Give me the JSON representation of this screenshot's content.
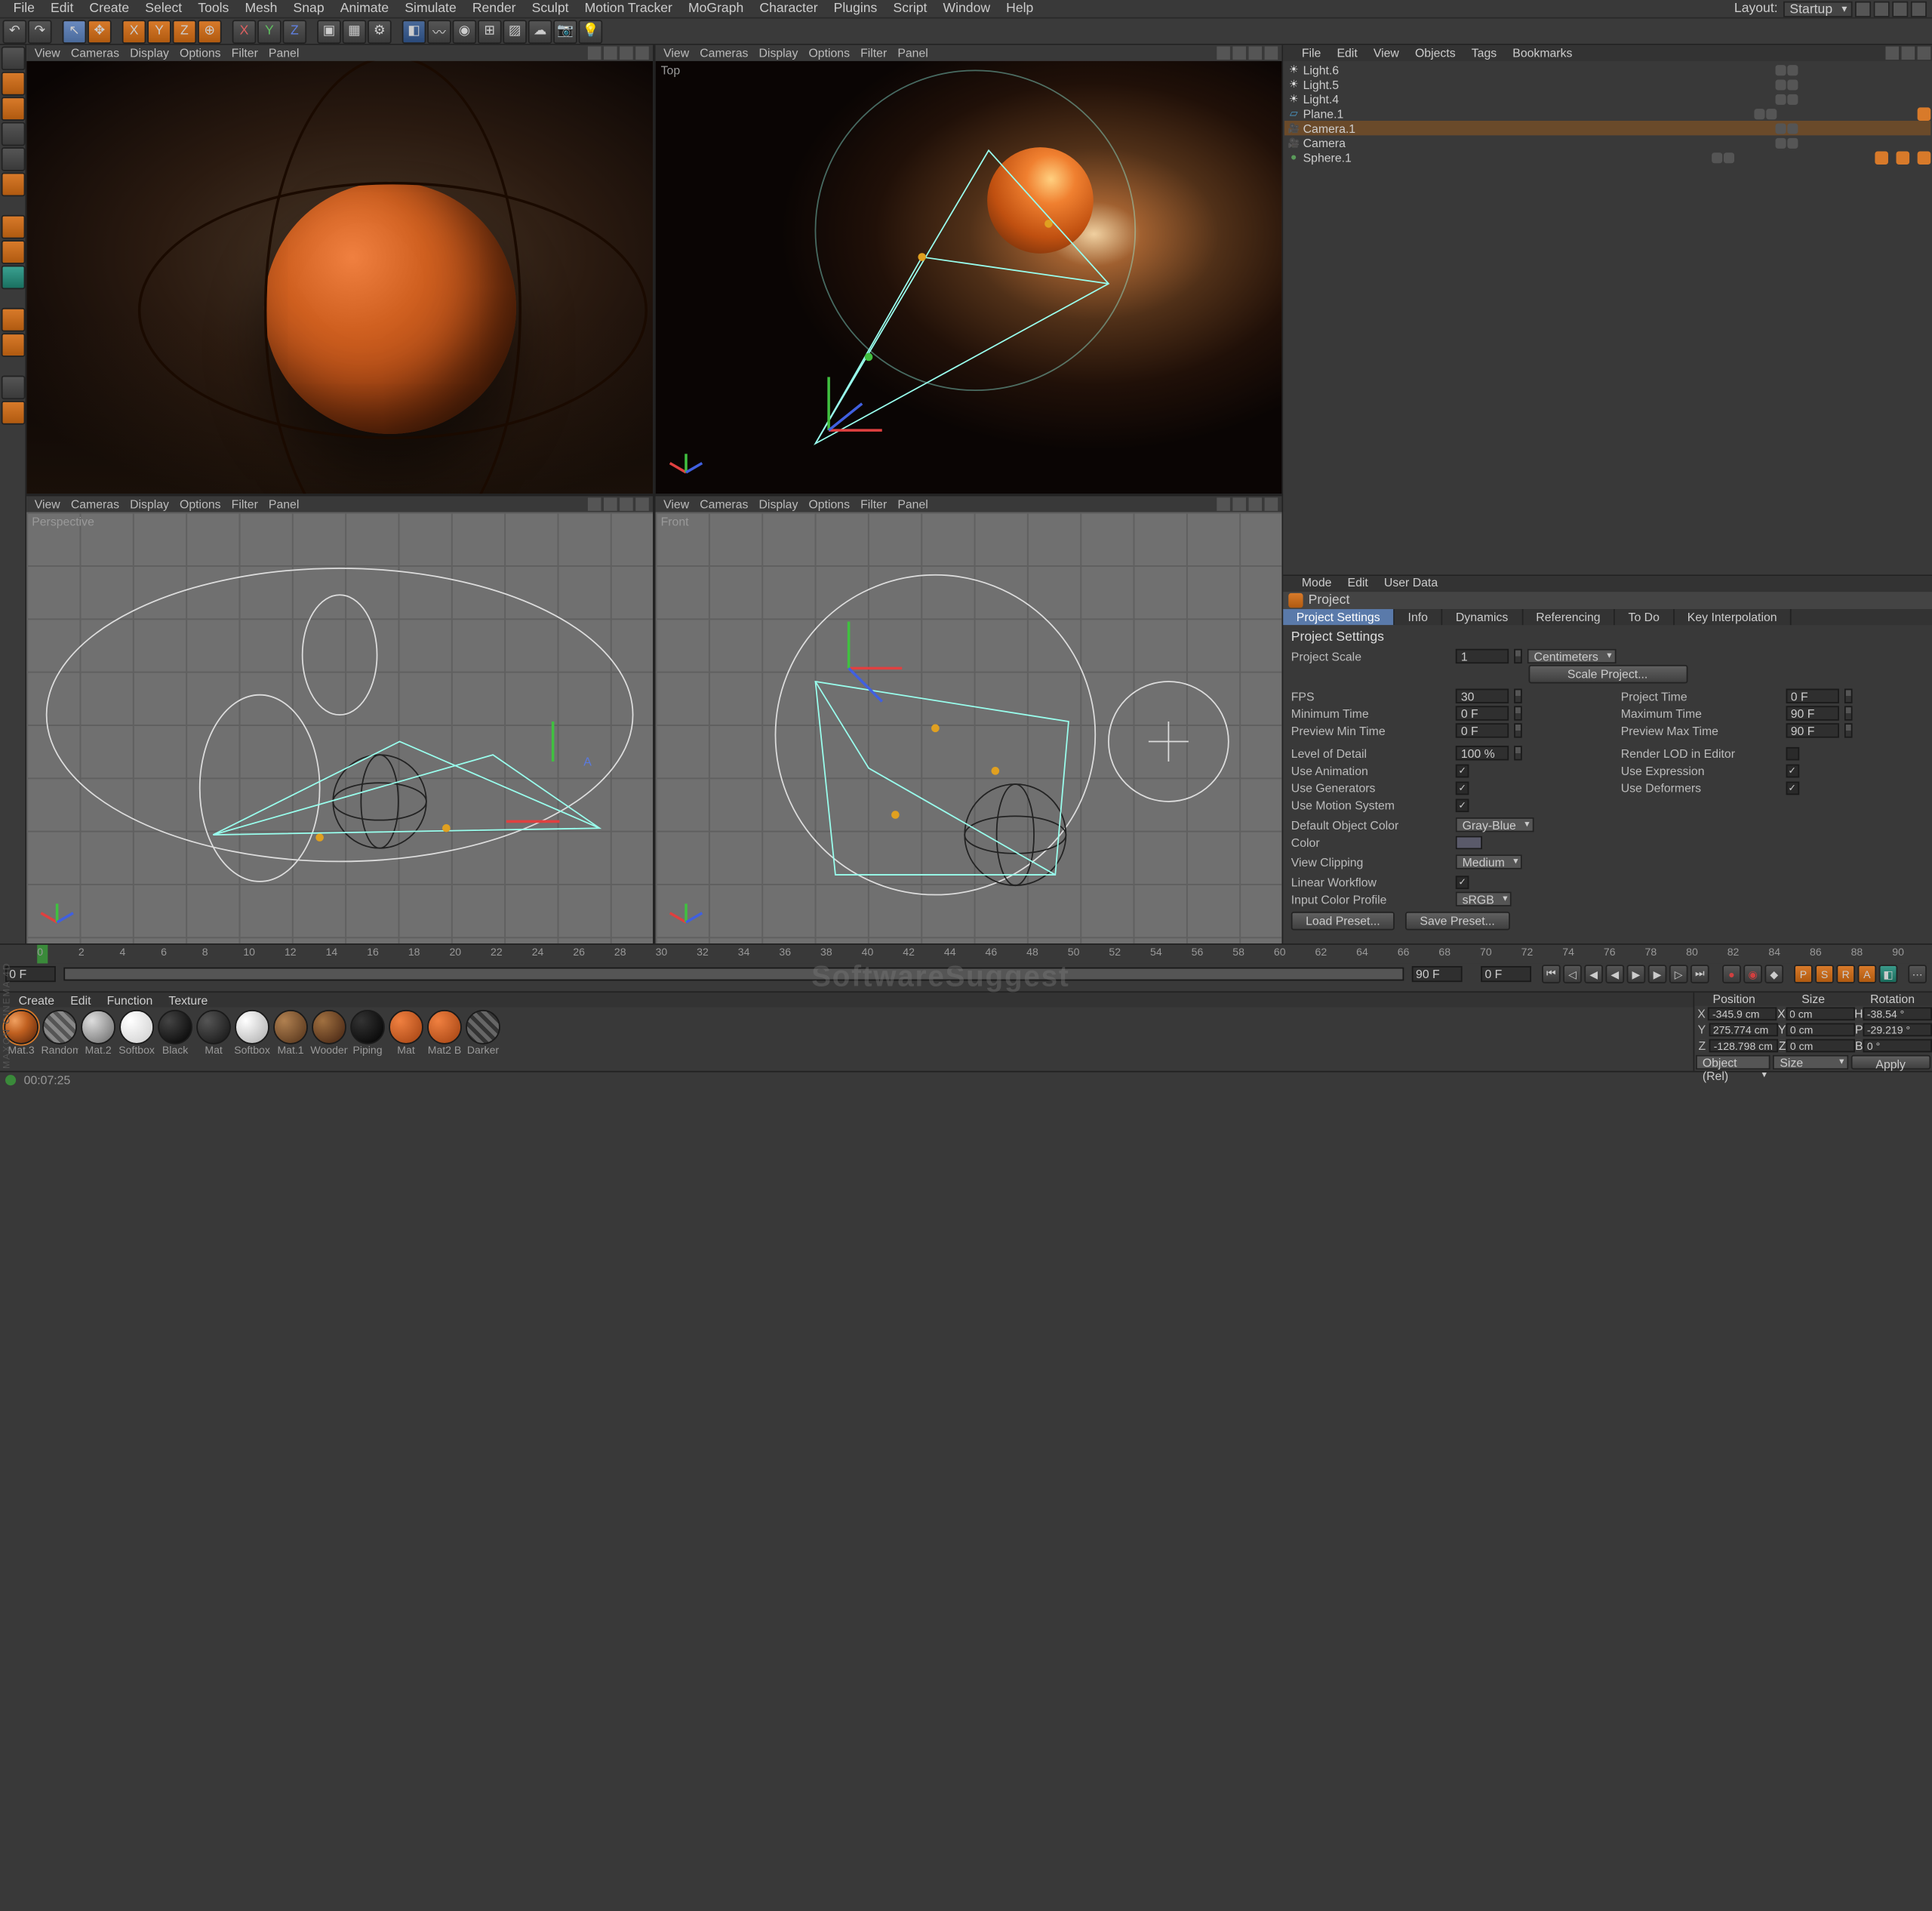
{
  "menu": {
    "items": [
      "File",
      "Edit",
      "Create",
      "Select",
      "Tools",
      "Mesh",
      "Snap",
      "Animate",
      "Simulate",
      "Render",
      "Sculpt",
      "Motion Tracker",
      "MoGraph",
      "Character",
      "Plugins",
      "Script",
      "Window",
      "Help"
    ],
    "layout_lbl": "Layout:",
    "layout_val": "Startup"
  },
  "viewport_menu": {
    "items": [
      "View",
      "Cameras",
      "Display",
      "Options",
      "Filter",
      "Panel"
    ]
  },
  "viewports": {
    "labels": [
      "",
      "Top",
      "Perspective",
      "Front"
    ]
  },
  "obj_panel": {
    "tabs": [
      "File",
      "Edit",
      "View",
      "Objects",
      "Tags",
      "Bookmarks"
    ],
    "rows": [
      {
        "name": "Light.6",
        "icon": "light"
      },
      {
        "name": "Light.5",
        "icon": "light"
      },
      {
        "name": "Light.4",
        "icon": "light"
      },
      {
        "name": "Plane.1",
        "icon": "plane",
        "tag": true
      },
      {
        "name": "Camera.1",
        "icon": "cam",
        "sel": true
      },
      {
        "name": "Camera",
        "icon": "cam"
      },
      {
        "name": "Sphere.1",
        "icon": "sphere",
        "tags": 3
      }
    ]
  },
  "attr": {
    "mode_tabs": [
      "Mode",
      "Edit",
      "User Data"
    ],
    "title": "Project",
    "subtabs": [
      "Project Settings",
      "Info",
      "Dynamics",
      "Referencing",
      "To Do",
      "Key Interpolation"
    ],
    "section_title": "Project Settings",
    "project_scale_lbl": "Project Scale",
    "project_scale_val": "1",
    "project_scale_unit": "Centimeters",
    "scale_btn": "Scale Project...",
    "fps_lbl": "FPS",
    "fps_val": "30",
    "project_time_lbl": "Project Time",
    "project_time_val": "0 F",
    "min_time_lbl": "Minimum Time",
    "min_time_val": "0 F",
    "max_time_lbl": "Maximum Time",
    "max_time_val": "90 F",
    "prev_min_lbl": "Preview Min Time",
    "prev_min_val": "0 F",
    "prev_max_lbl": "Preview Max Time",
    "prev_max_val": "90 F",
    "lod_lbl": "Level of Detail",
    "lod_val": "100 %",
    "render_lod_lbl": "Render LOD in Editor",
    "use_anim": "Use Animation",
    "use_expr": "Use Expression",
    "use_gen": "Use Generators",
    "use_def": "Use Deformers",
    "use_motion": "Use Motion System",
    "def_color_lbl": "Default Object Color",
    "def_color_val": "Gray-Blue",
    "color_lbl": "Color",
    "view_clip_lbl": "View Clipping",
    "view_clip_val": "Medium",
    "lin_wf": "Linear Workflow",
    "icp_lbl": "Input Color Profile",
    "icp_val": "sRGB",
    "load_preset": "Load Preset...",
    "save_preset": "Save Preset..."
  },
  "timeline": {
    "start": "0 F",
    "end": "90 F",
    "cur": "0 F",
    "max": "90 F",
    "marks": [
      0,
      2,
      4,
      6,
      8,
      10,
      12,
      14,
      16,
      18,
      20,
      22,
      24,
      26,
      28,
      30,
      32,
      34,
      36,
      38,
      40,
      42,
      44,
      46,
      48,
      50,
      52,
      54,
      56,
      58,
      60,
      62,
      64,
      66,
      68,
      70,
      72,
      74,
      76,
      78,
      80,
      82,
      84,
      86,
      88,
      90
    ]
  },
  "materials": {
    "tabs": [
      "Create",
      "Edit",
      "Function",
      "Texture"
    ],
    "items": [
      {
        "name": "Mat.3",
        "bg": "radial-gradient(circle at 30% 30%,#f0a060,#c06020 40%,#502008)",
        "sel": true
      },
      {
        "name": "Random",
        "bg": "repeating-linear-gradient(45deg,#888,#888 3px,#555 3px,#555 6px)"
      },
      {
        "name": "Mat.2",
        "bg": "radial-gradient(circle at 30% 30%,#ddd,#666)"
      },
      {
        "name": "Softbox",
        "bg": "radial-gradient(circle at 30% 30%,#fff,#ccc)"
      },
      {
        "name": "Black",
        "bg": "radial-gradient(circle at 30% 30%,#444,#000)"
      },
      {
        "name": "Mat",
        "bg": "radial-gradient(circle at 30% 30%,#555,#111)"
      },
      {
        "name": "Softbox",
        "bg": "radial-gradient(circle at 30% 30%,#fff,#aaa)"
      },
      {
        "name": "Mat.1",
        "bg": "radial-gradient(circle at 30% 30%,#b08050,#503018)"
      },
      {
        "name": "Wooden",
        "bg": "radial-gradient(circle at 30% 30%,#a07040,#402010)"
      },
      {
        "name": "Piping",
        "bg": "radial-gradient(circle at 30% 30%,#333,#000)"
      },
      {
        "name": "Mat",
        "bg": "radial-gradient(circle at 30% 30%,#f08040,#a04010)"
      },
      {
        "name": "Mat2 B",
        "bg": "radial-gradient(circle at 30% 30%,#f08040,#a04010)"
      },
      {
        "name": "Darker",
        "bg": "repeating-linear-gradient(45deg,#666,#666 3px,#333 3px,#333 6px)"
      }
    ]
  },
  "coords": {
    "headers": [
      "Position",
      "Size",
      "Rotation"
    ],
    "rows": [
      {
        "axis": "X",
        "p": "-345.9 cm",
        "s": "0 cm",
        "r_lbl": "H",
        "r": "-38.54 °"
      },
      {
        "axis": "Y",
        "p": "275.774 cm",
        "s": "0 cm",
        "r_lbl": "P",
        "r": "-29.219 °"
      },
      {
        "axis": "Z",
        "p": "-128.798 cm",
        "s": "0 cm",
        "r_lbl": "B",
        "r": "0 °"
      }
    ],
    "mode": "Object (Rel)",
    "size_mode": "Size",
    "apply": "Apply"
  },
  "status": {
    "time": "00:07:25"
  },
  "watermark": "SoftwareSuggest"
}
